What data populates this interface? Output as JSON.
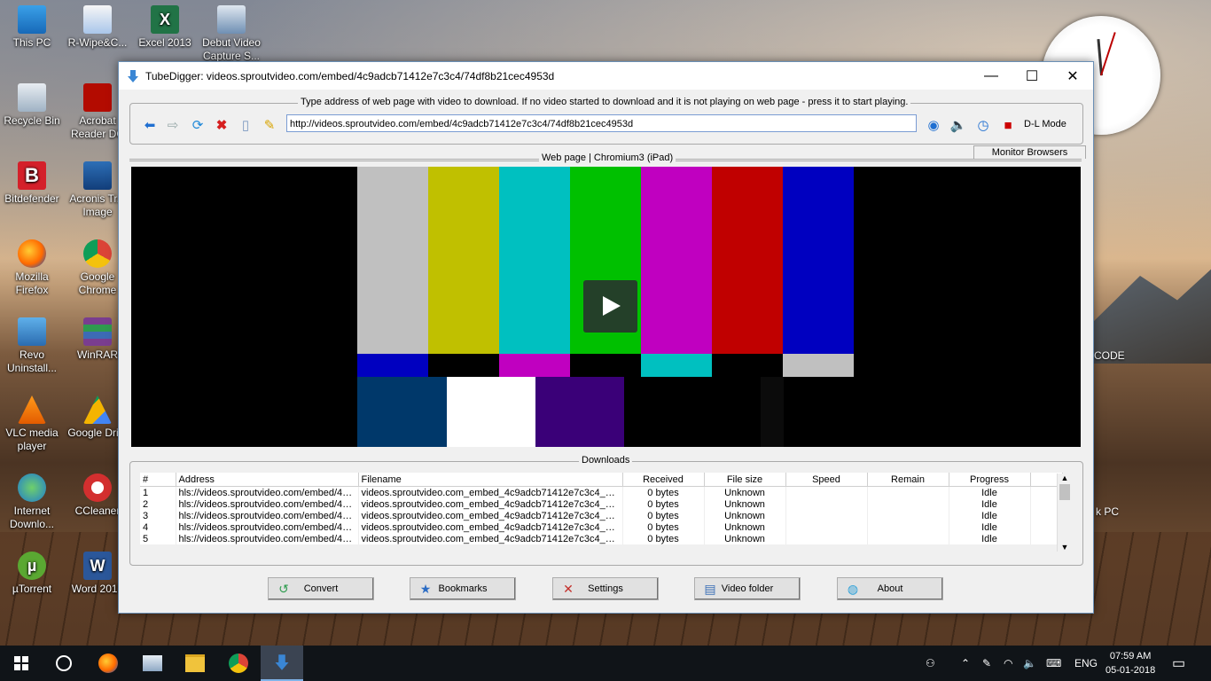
{
  "desktop": {
    "icons": [
      {
        "label": "This PC"
      },
      {
        "label": "R-Wipe&C..."
      },
      {
        "label": "Excel 2013"
      },
      {
        "label": "Debut Video Capture S..."
      },
      {
        "label": "Recycle Bin"
      },
      {
        "label": "Acrobat Reader DC"
      },
      {
        "label": "Bitdefender"
      },
      {
        "label": "Acronis Tr... Image"
      },
      {
        "label": "Mozilla Firefox"
      },
      {
        "label": "Google Chrome"
      },
      {
        "label": "Revo Uninstall..."
      },
      {
        "label": "WinRAR"
      },
      {
        "label": "VLC media player"
      },
      {
        "label": "Google Dri..."
      },
      {
        "label": "Internet Downlo..."
      },
      {
        "label": "CCleaner"
      },
      {
        "label": "µTorrent"
      },
      {
        "label": "Word 2013"
      }
    ],
    "partial_right": [
      "CODE",
      "k PC"
    ]
  },
  "window": {
    "title": "TubeDigger: videos.sproutvideo.com/embed/4c9adcb71412e7c3c4/74df8b21cec4953d",
    "controls": {
      "minimize": "—",
      "maximize": "☐",
      "close": "✕"
    },
    "address_group_label": "Type address of web page with video to download. If no video started to download and it is not playing on web page - press it to start playing.",
    "url_value": "http://videos.sproutvideo.com/embed/4c9adcb71412e7c3c4/74df8b21cec4953d",
    "dl_mode_label": "D-L Mode",
    "web_page_label": "Web page | Chromium3 (iPad)",
    "monitor_browsers_label": "Monitor Browsers",
    "downloads_label": "Downloads",
    "columns": [
      "#",
      "Address",
      "Filename",
      "Received",
      "File size",
      "Speed",
      "Remain",
      "Progress"
    ],
    "rows": [
      {
        "num": "1",
        "address": "hls://videos.sproutvideo.com/embed/4c...",
        "filename": "videos.sproutvideo.com_embed_4c9adcb71412e7c3c4_74...",
        "received": "0 bytes",
        "size": "Unknown",
        "speed": "",
        "remain": "",
        "progress": "Idle"
      },
      {
        "num": "2",
        "address": "hls://videos.sproutvideo.com/embed/4c...",
        "filename": "videos.sproutvideo.com_embed_4c9adcb71412e7c3c4_74...",
        "received": "0 bytes",
        "size": "Unknown",
        "speed": "",
        "remain": "",
        "progress": "Idle"
      },
      {
        "num": "3",
        "address": "hls://videos.sproutvideo.com/embed/4c...",
        "filename": "videos.sproutvideo.com_embed_4c9adcb71412e7c3c4_74...",
        "received": "0 bytes",
        "size": "Unknown",
        "speed": "",
        "remain": "",
        "progress": "Idle"
      },
      {
        "num": "4",
        "address": "hls://videos.sproutvideo.com/embed/4c...",
        "filename": "videos.sproutvideo.com_embed_4c9adcb71412e7c3c4_74...",
        "received": "0 bytes",
        "size": "Unknown",
        "speed": "",
        "remain": "",
        "progress": "Idle"
      },
      {
        "num": "5",
        "address": "hls://videos.sproutvideo.com/embed/4c...",
        "filename": "videos.sproutvideo.com_embed_4c9adcb71412e7c3c4_74...",
        "received": "0 bytes",
        "size": "Unknown",
        "speed": "",
        "remain": "",
        "progress": "Idle"
      }
    ],
    "buttons": {
      "convert": "Convert",
      "bookmarks": "Bookmarks",
      "settings": "Settings",
      "video_folder": "Video folder",
      "about": "About"
    }
  },
  "taskbar": {
    "language": "ENG",
    "time": "07:59 AM",
    "date": "05-01-2018"
  },
  "colors": {
    "accent": "#0078d7",
    "window_border": "#6a8fb5"
  }
}
